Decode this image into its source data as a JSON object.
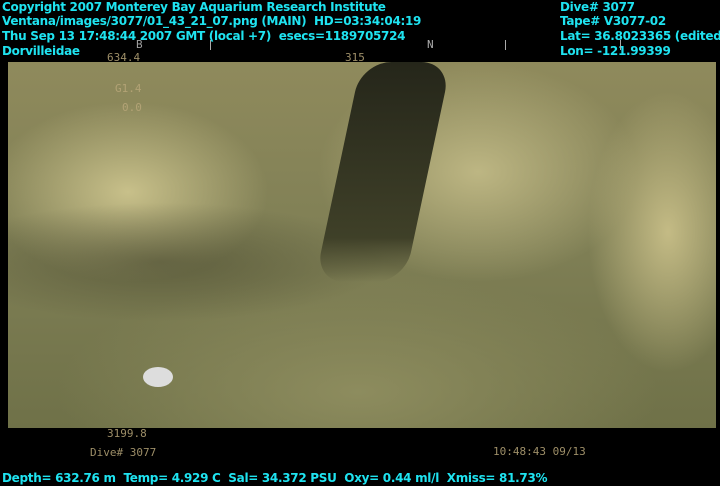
{
  "header_left": {
    "copyright": "Copyright 2007 Monterey Bay Aquarium Research Institute",
    "image_path": "Ventana/images/3077/01_43_21_07.png (MAIN)  HD=03:34:04:19",
    "datetime": "Thu Sep 13 17:48:44 2007 GMT (local +7)  esecs=1189705724",
    "taxon": "Dorvilleidae"
  },
  "header_right": {
    "dive": "Dive# 3077",
    "tape": "Tape# V3077-02",
    "lat": "Lat= 36.8023365 (edited)",
    "lon": "Lon= -121.99399"
  },
  "video_overlay": {
    "depth_readout": "634.4",
    "heading_readout": "315",
    "compass_n": "N",
    "compass_b": "B",
    "left_val1": "G1.4",
    "left_val2": "0.0",
    "bottom_readout": "3199.8",
    "dive_label": "Dive# 3077",
    "timestamp": "10:48:43 09/13"
  },
  "footer": {
    "ctd": "Depth= 632.76 m  Temp= 4.929 C  Sal= 34.372 PSU  Oxy= 0.44 ml/l  Xmiss= 81.73%"
  }
}
